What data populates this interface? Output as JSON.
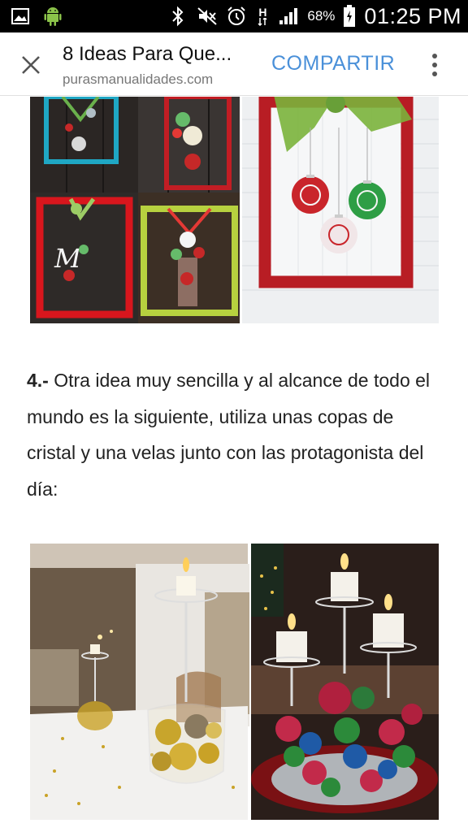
{
  "status_bar": {
    "battery_percent": "68%",
    "time": "01:25 PM",
    "network_type": "H",
    "icons": [
      "image-icon",
      "android-icon",
      "bluetooth-icon",
      "mute-icon",
      "alarm-icon",
      "data-h-icon",
      "signal-icon",
      "battery-icon"
    ]
  },
  "app_bar": {
    "title": "8 Ideas Para Que...",
    "url": "purasmanualidades.com",
    "share_label": "COMPARTIR"
  },
  "article": {
    "number": "4.-",
    "text": " Otra idea muy sencilla y al alcance de todo el mundo es la siguiente, utiliza unas copas de cristal y una velas junto con las protagonista del día:"
  },
  "colors": {
    "share_accent": "#4a90d9",
    "status_bar_bg": "#000000"
  }
}
